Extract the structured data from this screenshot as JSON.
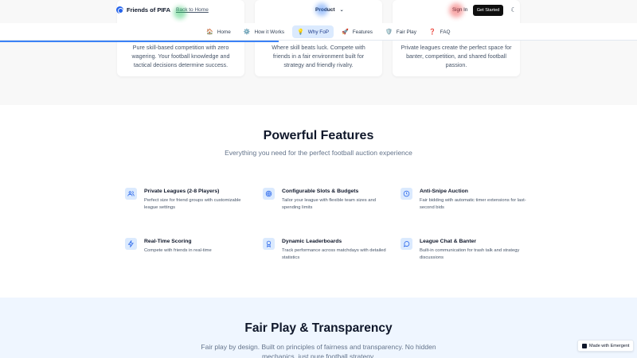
{
  "header": {
    "brand": "Friends of PIFA",
    "back_link": "Back to Home",
    "product_menu": "Product",
    "sign_in": "Sign In",
    "get_started": "Get Started",
    "theme_icon": "moon-icon"
  },
  "nav": {
    "items": [
      {
        "icon": "🏠",
        "label": "Home"
      },
      {
        "icon": "⚙️",
        "label": "How it Works"
      },
      {
        "icon": "💡",
        "label": "Why FoP"
      },
      {
        "icon": "🚀",
        "label": "Features"
      },
      {
        "icon": "🛡️",
        "label": "Fair Play"
      },
      {
        "icon": "❓",
        "label": "FAQ"
      }
    ],
    "active": "Why FoP"
  },
  "top_cards": [
    {
      "text": "Pure skill-based competition with zero wagering. Your football knowledge and tactical decisions determine success."
    },
    {
      "text": "Where skill beats luck. Compete with friends in a fair environment built for strategy and friendly rivalry."
    },
    {
      "text": "Private leagues create the perfect space for banter, competition, and shared football passion."
    }
  ],
  "features": {
    "title": "Powerful Features",
    "subtitle": "Everything you need for the perfect football auction experience",
    "items": [
      {
        "icon": "users-icon",
        "title": "Private Leagues (2-8 Players)",
        "desc": "Perfect size for friend groups with customizable league settings"
      },
      {
        "icon": "target-icon",
        "title": "Configurable Slots & Budgets",
        "desc": "Tailor your league with flexible team sizes and spending limits"
      },
      {
        "icon": "clock-icon",
        "title": "Anti-Snipe Auction",
        "desc": "Fair bidding with automatic timer extensions for last-second bids"
      },
      {
        "icon": "bolt-icon",
        "title": "Real-Time Scoring",
        "desc": "Compete with friends in real-time"
      },
      {
        "icon": "award-icon",
        "title": "Dynamic Leaderboards",
        "desc": "Track performance across matchdays with detailed statistics"
      },
      {
        "icon": "chat-icon",
        "title": "League Chat & Banter",
        "desc": "Built-in communication for trash talk and strategy discussions"
      }
    ]
  },
  "fair_play": {
    "title": "Fair Play & Transparency",
    "subtitle": "Fair play by design. Built on principles of fairness and transparency. No hidden mechanics, just pure football strategy."
  },
  "badge": {
    "label": "Made with Emergent"
  },
  "colors": {
    "accent": "#2563eb",
    "icon_bg": "#dbeafe",
    "nav_active": "#dbeafe",
    "fair_bg": "#eff6ff"
  }
}
